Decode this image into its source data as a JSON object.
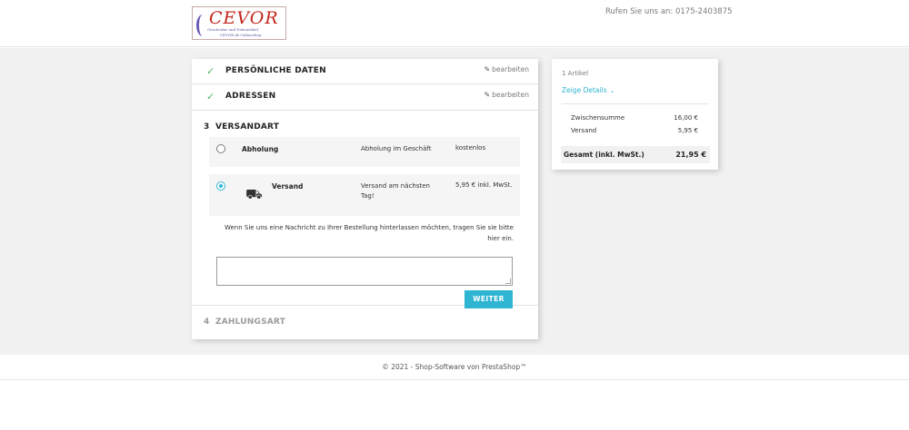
{
  "header": {
    "logo_name": "CEVOR",
    "logo_sub1": "Geschenke und Dekoartikel",
    "logo_sub2": "CEVOR.de Onlineshop",
    "phone": "Rufen Sie uns an: 0175-2403875"
  },
  "steps": {
    "personal": {
      "title": "Persönliche Daten",
      "edit": "bearbeiten"
    },
    "addresses": {
      "title": "Adressen",
      "edit": "bearbeiten"
    },
    "shipping": {
      "number": "3",
      "title": "Versandart",
      "options": [
        {
          "name": "Abholung",
          "delay": "Abholung im Geschäft",
          "price": "kostenlos",
          "selected": false
        },
        {
          "name": "Versand",
          "delay": "Versand am nächsten Tag!",
          "price": "5,95 € inkl. MwSt.",
          "selected": true,
          "icon": "truck-icon"
        }
      ],
      "message_label": "Wenn Sie uns eine Nachricht zu Ihrer Bestellung hinterlassen möchten, tragen Sie sie bitte hier ein.",
      "message_value": "",
      "continue_button": "WEITER"
    },
    "payment": {
      "number": "4",
      "title": "Zahlungsart"
    }
  },
  "summary": {
    "count": "1 Artikel",
    "details_link": "Zeige Details",
    "subtotal_label": "Zwischensumme",
    "subtotal_value": "16,00 €",
    "shipping_label": "Versand",
    "shipping_value": "5,95 €",
    "total_label": "Gesamt (inkl. MwSt.)",
    "total_value": "21,95 €"
  },
  "footer": {
    "text": "© 2021 - Shop-Software von PrestaShop™"
  },
  "colors": {
    "accent": "#2fb5d2",
    "check": "#4cbb6c",
    "background": "#f1f1f1"
  }
}
